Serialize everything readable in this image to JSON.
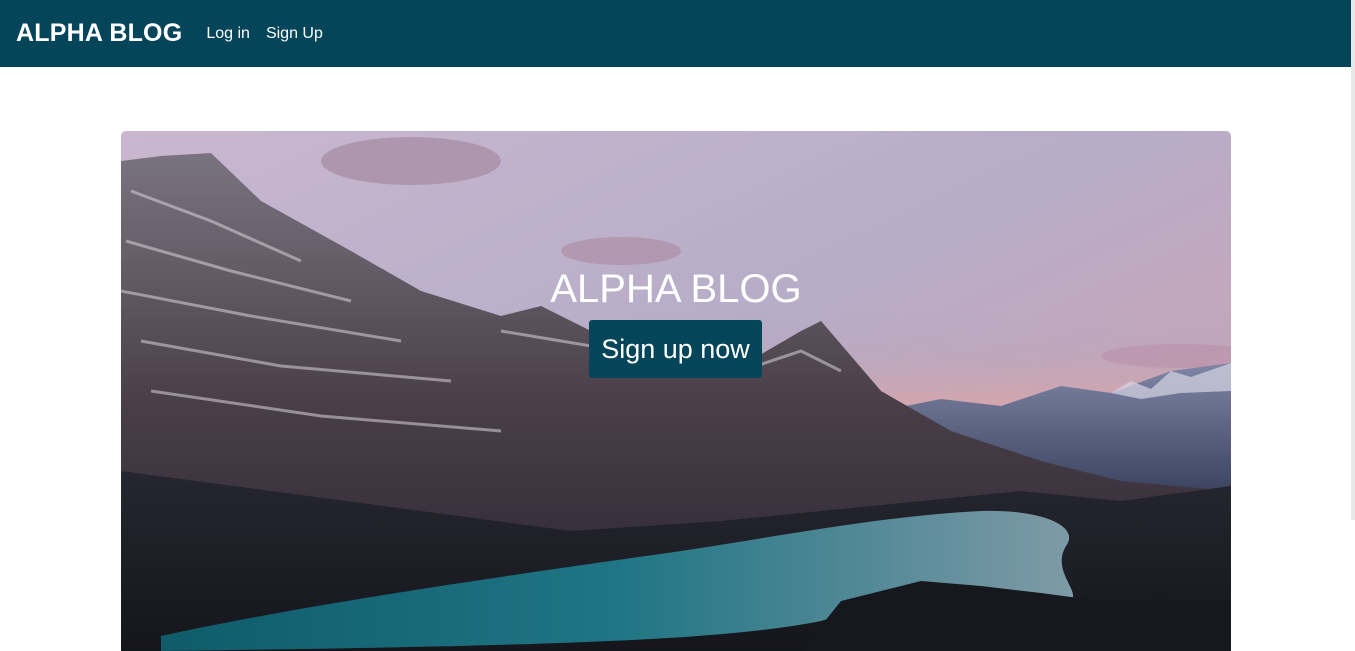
{
  "navbar": {
    "brand": "ALPHA BLOG",
    "links": [
      {
        "label": "Log in"
      },
      {
        "label": "Sign Up"
      }
    ],
    "bg_color": "#05455a"
  },
  "hero": {
    "title": "ALPHA BLOG",
    "cta_label": "Sign up now",
    "image_description": "mountain-lake-landscape",
    "button_color": "#05455a"
  }
}
